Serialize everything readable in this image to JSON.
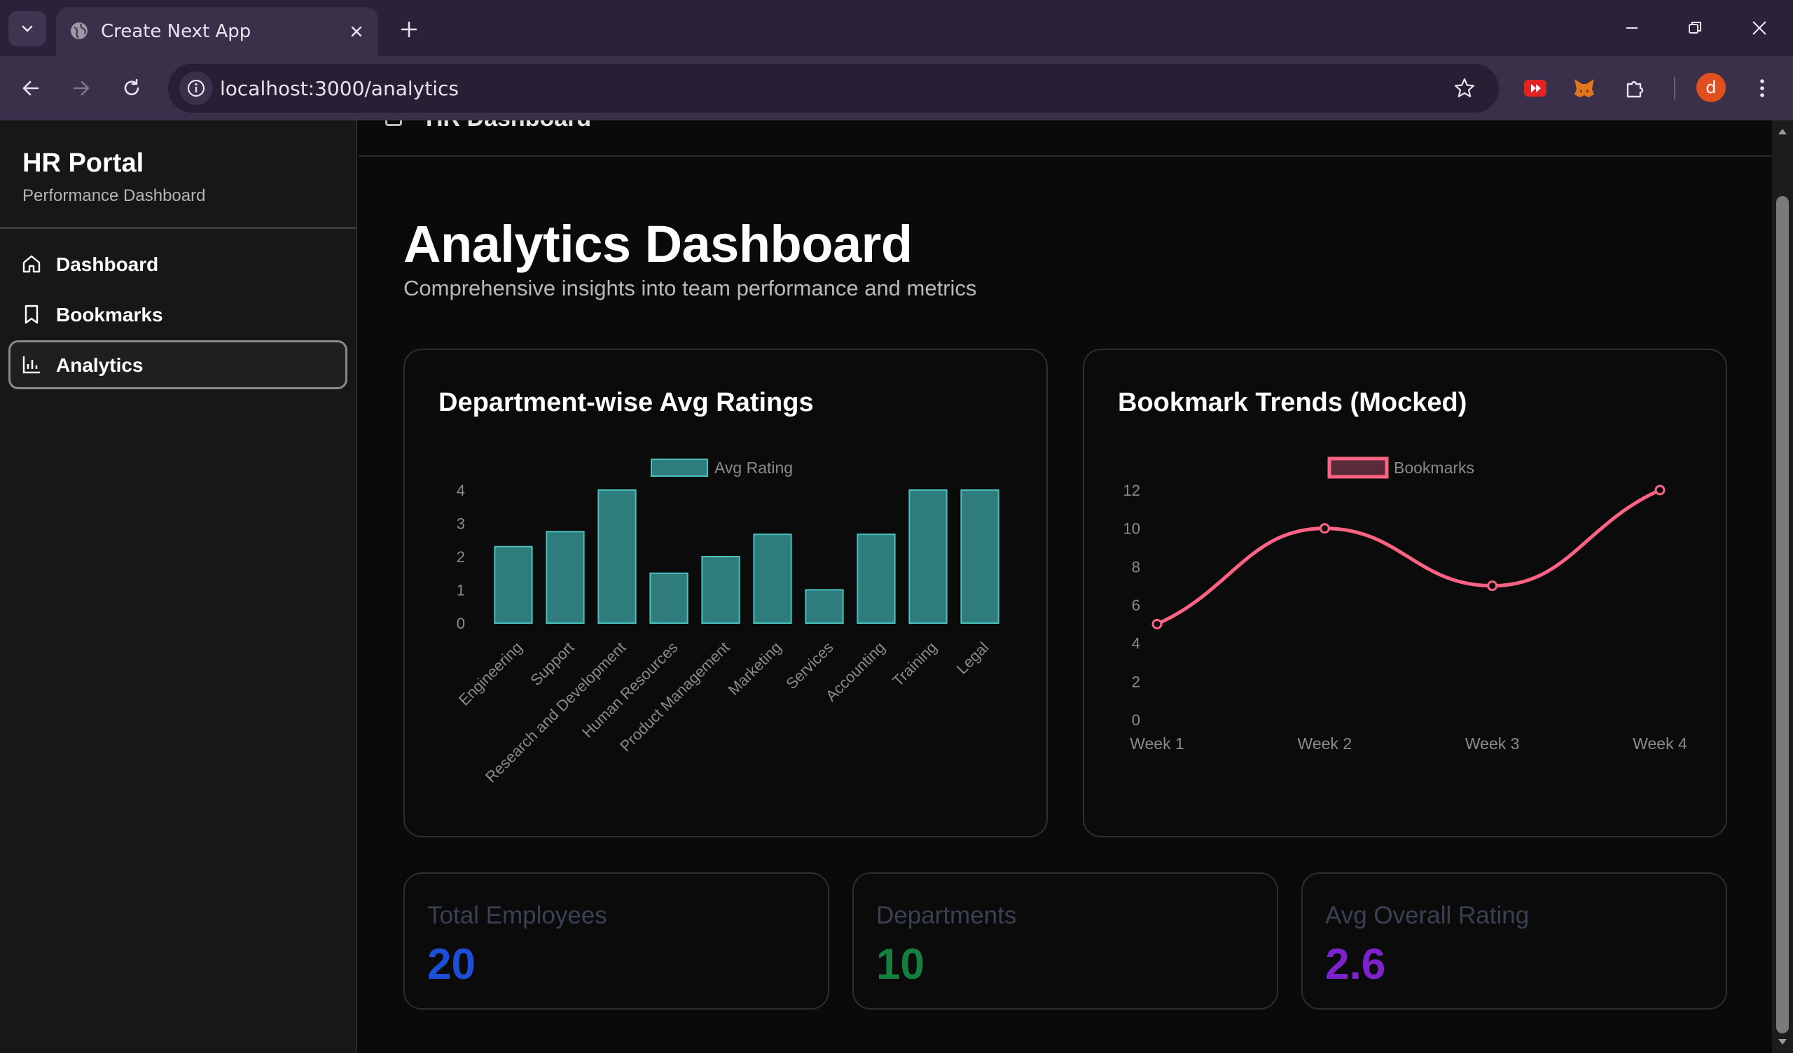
{
  "browser": {
    "tab_title": "Create Next App",
    "url": "localhost:3000/analytics",
    "profile_initial": "d"
  },
  "sidebar": {
    "title": "HR Portal",
    "subtitle": "Performance Dashboard",
    "items": [
      {
        "label": "Dashboard",
        "icon": "home-icon",
        "active": false
      },
      {
        "label": "Bookmarks",
        "icon": "bookmark-icon",
        "active": false
      },
      {
        "label": "Analytics",
        "icon": "bar-chart-icon",
        "active": true
      }
    ]
  },
  "topbar": {
    "title": "HR Dashboard"
  },
  "page": {
    "title": "Analytics Dashboard",
    "subtitle": "Comprehensive insights into team performance and metrics"
  },
  "cards": {
    "ratings_title": "Department-wise Avg Ratings",
    "trends_title": "Bookmark Trends (Mocked)"
  },
  "stats": [
    {
      "label": "Total Employees",
      "value": "20",
      "color": "#1d4ed8"
    },
    {
      "label": "Departments",
      "value": "10",
      "color": "#15803d"
    },
    {
      "label": "Avg Overall Rating",
      "value": "2.6",
      "color": "#7e22ce"
    }
  ],
  "chart_data": [
    {
      "type": "bar",
      "title": "Department-wise Avg Ratings",
      "categories": [
        "Engineering",
        "Support",
        "Research and Development",
        "Human Resources",
        "Product Management",
        "Marketing",
        "Services",
        "Accounting",
        "Training",
        "Legal"
      ],
      "series": [
        {
          "name": "Avg Rating",
          "values": [
            2.3,
            2.75,
            4,
            1.5,
            2,
            2.67,
            1,
            2.67,
            4,
            4
          ]
        }
      ],
      "yticks": [
        "0",
        "1",
        "2",
        "3",
        "4"
      ],
      "ylim": [
        0,
        4
      ],
      "legend": "top",
      "grid": false,
      "colors": {
        "fill": "#2e7c7c",
        "stroke": "#4bc0c0",
        "text": "#8a8a8a"
      }
    },
    {
      "type": "line",
      "title": "Bookmark Trends (Mocked)",
      "categories": [
        "Week 1",
        "Week 2",
        "Week 3",
        "Week 4"
      ],
      "series": [
        {
          "name": "Bookmarks",
          "values": [
            5,
            10,
            7,
            12
          ]
        }
      ],
      "yticks": [
        "0",
        "2",
        "4",
        "6",
        "8",
        "10",
        "12"
      ],
      "ylim": [
        0,
        12
      ],
      "legend": "top",
      "grid": false,
      "colors": {
        "line": "#ff6384",
        "legend_fill": "#5a2a38",
        "text": "#8a8a8a"
      }
    }
  ]
}
